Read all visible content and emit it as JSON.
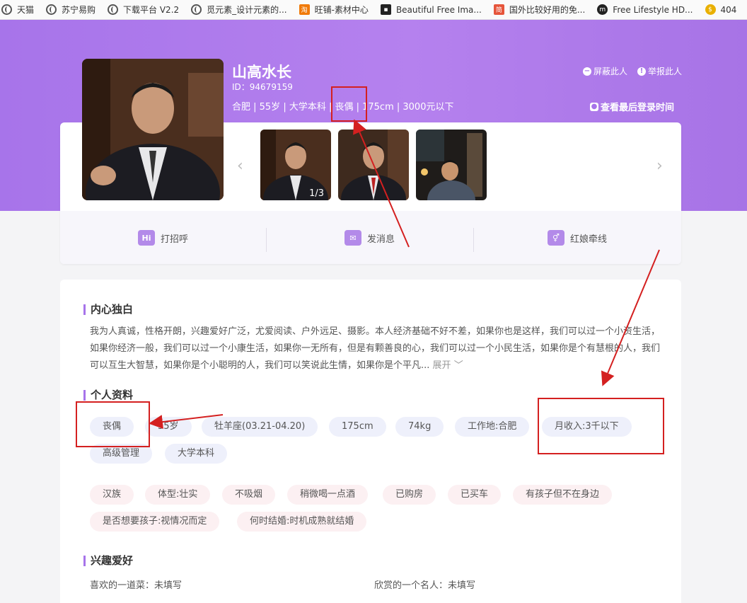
{
  "bookmarks": [
    {
      "label": "天猫",
      "icon": "globe-icon"
    },
    {
      "label": "苏宁易购",
      "icon": "globe-icon"
    },
    {
      "label": "下载平台 V2.2",
      "icon": "globe-icon"
    },
    {
      "label": "觅元素_设计元素的...",
      "icon": "globe-icon"
    },
    {
      "label": "旺铺-素材中心",
      "icon": "taobao-icon"
    },
    {
      "label": "Beautiful Free Ima...",
      "icon": "camera-icon"
    },
    {
      "label": "国外比较好用的免...",
      "icon": "jian-icon"
    },
    {
      "label": "Free Lifestyle HD...",
      "icon": "m-icon"
    },
    {
      "label": "404",
      "icon": "coin-icon"
    }
  ],
  "profile": {
    "name": "山高水长",
    "id": "ID：94679159",
    "meta": "合肥 | 55岁 | 大学本科 | 丧偶 | 175cm | 3000元以下",
    "block_label": "屏蔽此人",
    "report_label": "举报此人",
    "last_login_label": "查看最后登录时间"
  },
  "gallery": {
    "counter": "1/3",
    "prev_icon": "chevron-left-icon",
    "next_icon": "chevron-right-icon"
  },
  "actions": {
    "greet_icon_text": "Hi",
    "greet": "打招呼",
    "message": "发消息",
    "matchmaker": "红娘牵线"
  },
  "monologue": {
    "title": "内心独白",
    "text": "我为人真诚，性格开朗，兴趣爱好广泛，尤爱阅读、户外远足、摄影。本人经济基础不好不差，如果你也是这样，我们可以过一个小资生活，如果你经济一般，我们可以过一个小康生活，如果你一无所有，但是有颗善良的心，我们可以过一个小民生活，如果你是个有慧根的人，我们可以互生大智慧，如果你是个小聪明的人，我们可以笑说此生情，如果你是个平凡...",
    "more": "展开"
  },
  "personal": {
    "title": "个人资料",
    "tags_blue": [
      "丧偶",
      "55岁",
      "牡羊座(03.21-04.20)",
      "175cm",
      "74kg",
      "工作地:合肥",
      "月收入:3千以下",
      "高级管理",
      "大学本科"
    ],
    "tags_pink": [
      "汉族",
      "体型:壮实",
      "不吸烟",
      "稍微喝一点酒",
      "已购房",
      "已买车",
      "有孩子但不在身边",
      "是否想要孩子:视情况而定",
      "何时结婚:时机成熟就结婚"
    ]
  },
  "hobbies": {
    "title": "兴趣爱好",
    "dish": "喜欢的一道菜：未填写",
    "celebrity": "欣赏的一个名人：未填写"
  },
  "colors": {
    "banner": "#a774ea",
    "annotation": "#d42020"
  }
}
